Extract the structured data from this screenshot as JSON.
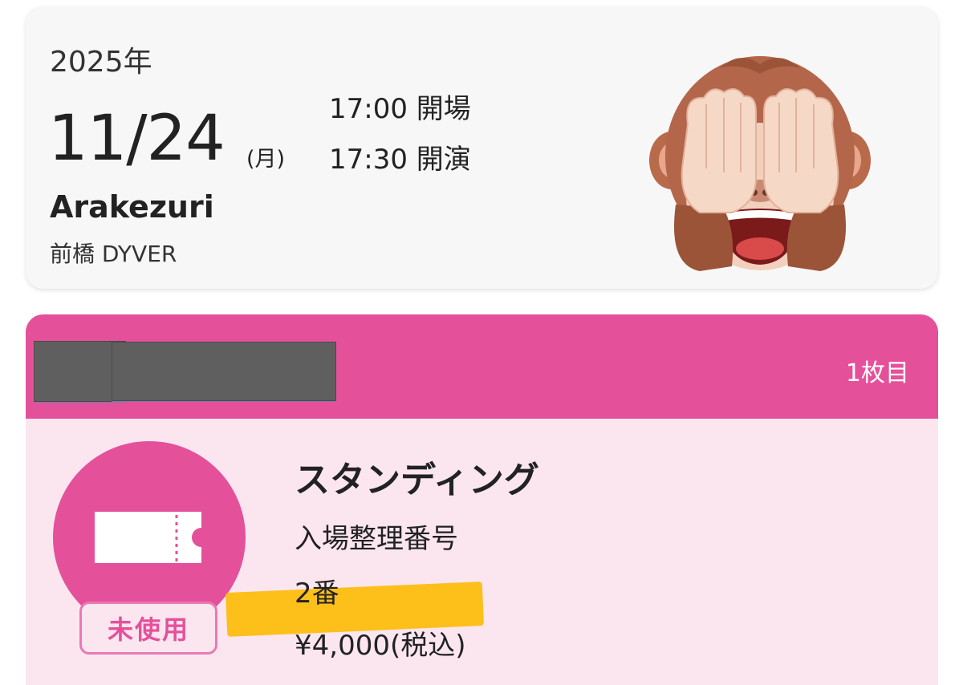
{
  "event": {
    "year": "2025年",
    "date": "11/24",
    "weekday": "(月)",
    "open_time": "17:00 開場",
    "start_time": "17:30 開演",
    "artist": "Arakezuri",
    "venue": "前橋 DYVER",
    "emoji": "see-no-evil-monkey"
  },
  "ticket": {
    "count_label": "1枚目",
    "seat_type": "スタンディング",
    "entry_label": "入場整理番号",
    "entry_number": "2番",
    "price": "¥4,000(税込)",
    "status": "未使用",
    "colors": {
      "accent": "#e5509b",
      "background": "#fbe6f0",
      "highlight": "#fdbf1a"
    }
  }
}
